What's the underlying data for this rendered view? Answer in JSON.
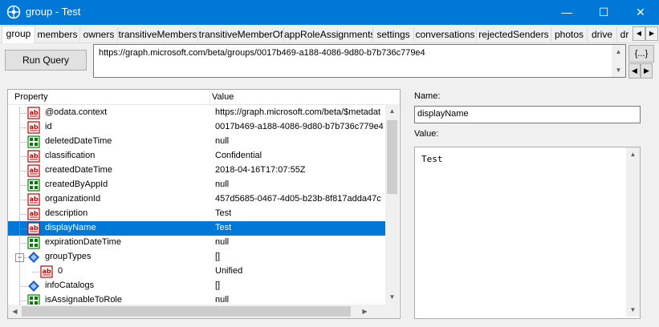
{
  "window": {
    "title": "group - Test",
    "minimize_glyph": "—",
    "maximize_glyph": "☐",
    "close_glyph": "✕"
  },
  "tabs": [
    "group",
    "members",
    "owners",
    "transitiveMembers",
    "transitiveMemberOf",
    "appRoleAssignments",
    "settings",
    "conversations",
    "rejectedSenders",
    "photos",
    "drive",
    "dr"
  ],
  "toolbar": {
    "run_query_label": "Run Query",
    "url": "https://graph.microsoft.com/beta/groups/0017b469-a188-4086-9d80-b7b736c779e4",
    "braces_label": "{...}"
  },
  "grid": {
    "header_property": "Property",
    "header_value": "Value",
    "rows": [
      {
        "property": "@odata.context",
        "value": "https://graph.microsoft.com/beta/$metadat",
        "icon": "string-icon"
      },
      {
        "property": "id",
        "value": "0017b469-a188-4086-9d80-b7b736c779e4",
        "icon": "string-icon"
      },
      {
        "property": "deletedDateTime",
        "value": "null",
        "icon": "null-icon"
      },
      {
        "property": "classification",
        "value": "Confidential",
        "icon": "string-icon"
      },
      {
        "property": "createdDateTime",
        "value": "2018-04-16T17:07:55Z",
        "icon": "string-icon"
      },
      {
        "property": "createdByAppId",
        "value": "null",
        "icon": "null-icon"
      },
      {
        "property": "organizationId",
        "value": "457d5685-0467-4d05-b23b-8f817adda47c",
        "icon": "string-icon"
      },
      {
        "property": "description",
        "value": "Test",
        "icon": "string-icon"
      },
      {
        "property": "displayName",
        "value": "Test",
        "icon": "string-icon",
        "selected": true
      },
      {
        "property": "expirationDateTime",
        "value": "null",
        "icon": "null-icon"
      },
      {
        "property": "groupTypes",
        "value": "[]",
        "icon": "array-icon",
        "expander": "−"
      },
      {
        "property": "0",
        "value": "Unified",
        "icon": "string-icon",
        "child": true
      },
      {
        "property": "infoCatalogs",
        "value": "[]",
        "icon": "array-icon"
      },
      {
        "property": "isAssignableToRole",
        "value": "null",
        "icon": "null-icon"
      }
    ]
  },
  "detail": {
    "name_label": "Name:",
    "name_value": "displayName",
    "value_label": "Value:",
    "value_text": "Test"
  },
  "colors": {
    "titlebar": "#0078d7",
    "selection": "#0078d7",
    "string_icon": "#c00000",
    "null_icon": "#008000",
    "array_icon": "#1e5fbf"
  }
}
